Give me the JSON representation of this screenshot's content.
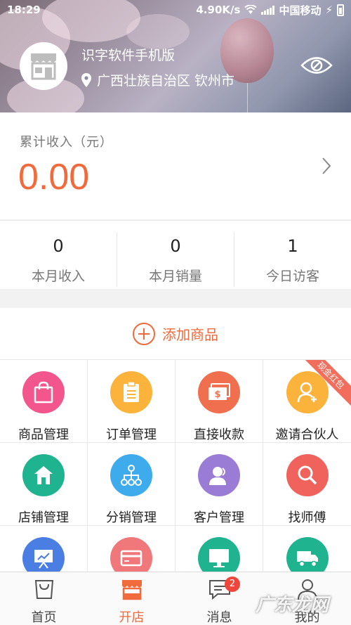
{
  "status_bar": {
    "time": "18:29",
    "speed": "4.90K/s",
    "carrier": "中国移动"
  },
  "header": {
    "shop_name": "识字软件手机版",
    "location": "广西壮族自治区 钦州市",
    "avatar_icon": "shop-storefront-icon",
    "eye_icon": "eye-icon"
  },
  "income": {
    "label": "累计收入（元）",
    "amount": "0.00",
    "accent": "#f06a3c"
  },
  "stats": [
    {
      "value": "0",
      "label": "本月收入"
    },
    {
      "value": "0",
      "label": "本月销量"
    },
    {
      "value": "1",
      "label": "今日访客"
    }
  ],
  "add_product": {
    "label": "添加商品"
  },
  "grid": [
    {
      "label": "商品管理",
      "icon": "shopping-bag-icon",
      "color": "#f2568c"
    },
    {
      "label": "订单管理",
      "icon": "order-list-icon",
      "color": "#fbb33b"
    },
    {
      "label": "直接收款",
      "icon": "cash-icon",
      "color": "#f06f4e"
    },
    {
      "label": "邀请合伙人",
      "icon": "add-person-icon",
      "color": "#fbb33b",
      "ribbon": "现金红包"
    },
    {
      "label": "店铺管理",
      "icon": "house-icon",
      "color": "#1fb38f"
    },
    {
      "label": "分销管理",
      "icon": "hierarchy-icon",
      "color": "#3eabec"
    },
    {
      "label": "客户管理",
      "icon": "customer-icon",
      "color": "#9a7bd6"
    },
    {
      "label": "找师傅",
      "icon": "search-icon",
      "color": "#f0625c"
    },
    {
      "label": "",
      "icon": "presentation-icon",
      "color": "#4a7ee3"
    },
    {
      "label": "",
      "icon": "card-icon",
      "color": "#f0777a"
    },
    {
      "label": "",
      "icon": "monitor-icon",
      "color": "#1fb38f"
    },
    {
      "label": "",
      "icon": "truck-icon",
      "color": "#1fb38f"
    }
  ],
  "tabbar": [
    {
      "label": "首页",
      "icon": "bag-outline-icon"
    },
    {
      "label": "开店",
      "icon": "store-icon",
      "active": true
    },
    {
      "label": "消息",
      "icon": "chat-icon",
      "badge": "2"
    },
    {
      "label": "我的",
      "icon": "person-icon"
    }
  ],
  "watermark": "广东龙网"
}
